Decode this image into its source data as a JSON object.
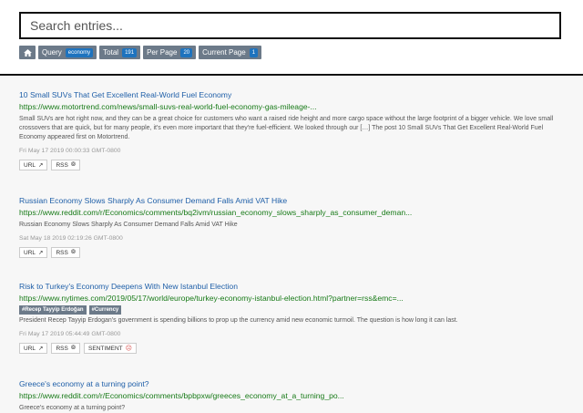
{
  "search": {
    "placeholder": "Search entries..."
  },
  "filters": {
    "query_label": "Query",
    "query_value": "economy",
    "total_label": "Total",
    "total_value": "191",
    "per_page_label": "Per Page",
    "per_page_value": "20",
    "current_page_label": "Current Page",
    "current_page_value": "1"
  },
  "entries": [
    {
      "title": "10 Small SUVs That Get Excellent Real-World Fuel Economy",
      "url": "https://www.motortrend.com/news/small-suvs-real-world-fuel-economy-gas-mileage-...",
      "desc": "Small SUVs are hot right now, and they can be a great choice for customers who want a raised ride height and more cargo space without the large footprint of a bigger vehicle. We love small crossovers that are quick, but for many people, it's even more important that they're fuel-efficient. We looked through our […] The post 10 Small SUVs That Get Excellent Real-World Fuel Economy appeared first on Motortrend.",
      "date": "Fri May 17 2019 00:00:33 GMT-0800",
      "url_btn": "URL",
      "rss_btn": "RSS"
    },
    {
      "title": "Russian Economy Slows Sharply As Consumer Demand Falls Amid VAT Hike",
      "url": "https://www.reddit.com/r/Economics/comments/bq2ivm/russian_economy_slows_sharply_as_consumer_deman...",
      "desc": "Russian Economy Slows Sharply As Consumer Demand Falls Amid VAT Hike",
      "date": "Sat May 18 2019 02:19:26 GMT-0800",
      "url_btn": "URL",
      "rss_btn": "RSS"
    },
    {
      "title": "Risk to Turkey's Economy Deepens With New Istanbul Election",
      "url": "https://www.nytimes.com/2019/05/17/world/europe/turkey-economy-istanbul-election.html?partner=rss&emc=...",
      "tags": [
        "#Recep Tayyip Erdoğan",
        "#Currency"
      ],
      "desc": "President Recep Tayyip Erdogan's government is spending billions to prop up the currency amid new economic turmoil. The question is how long it can last.",
      "date": "Fri May 17 2019 05:44:49 GMT-0800",
      "url_btn": "URL",
      "rss_btn": "RSS",
      "sentiment_btn": "SENTIMENT"
    },
    {
      "title": "Greece's economy at a turning point?",
      "url": "https://www.reddit.com/r/Economics/comments/bpbpxw/greeces_economy_at_a_turning_po...",
      "desc": "Greece's economy at a turning point?"
    }
  ]
}
